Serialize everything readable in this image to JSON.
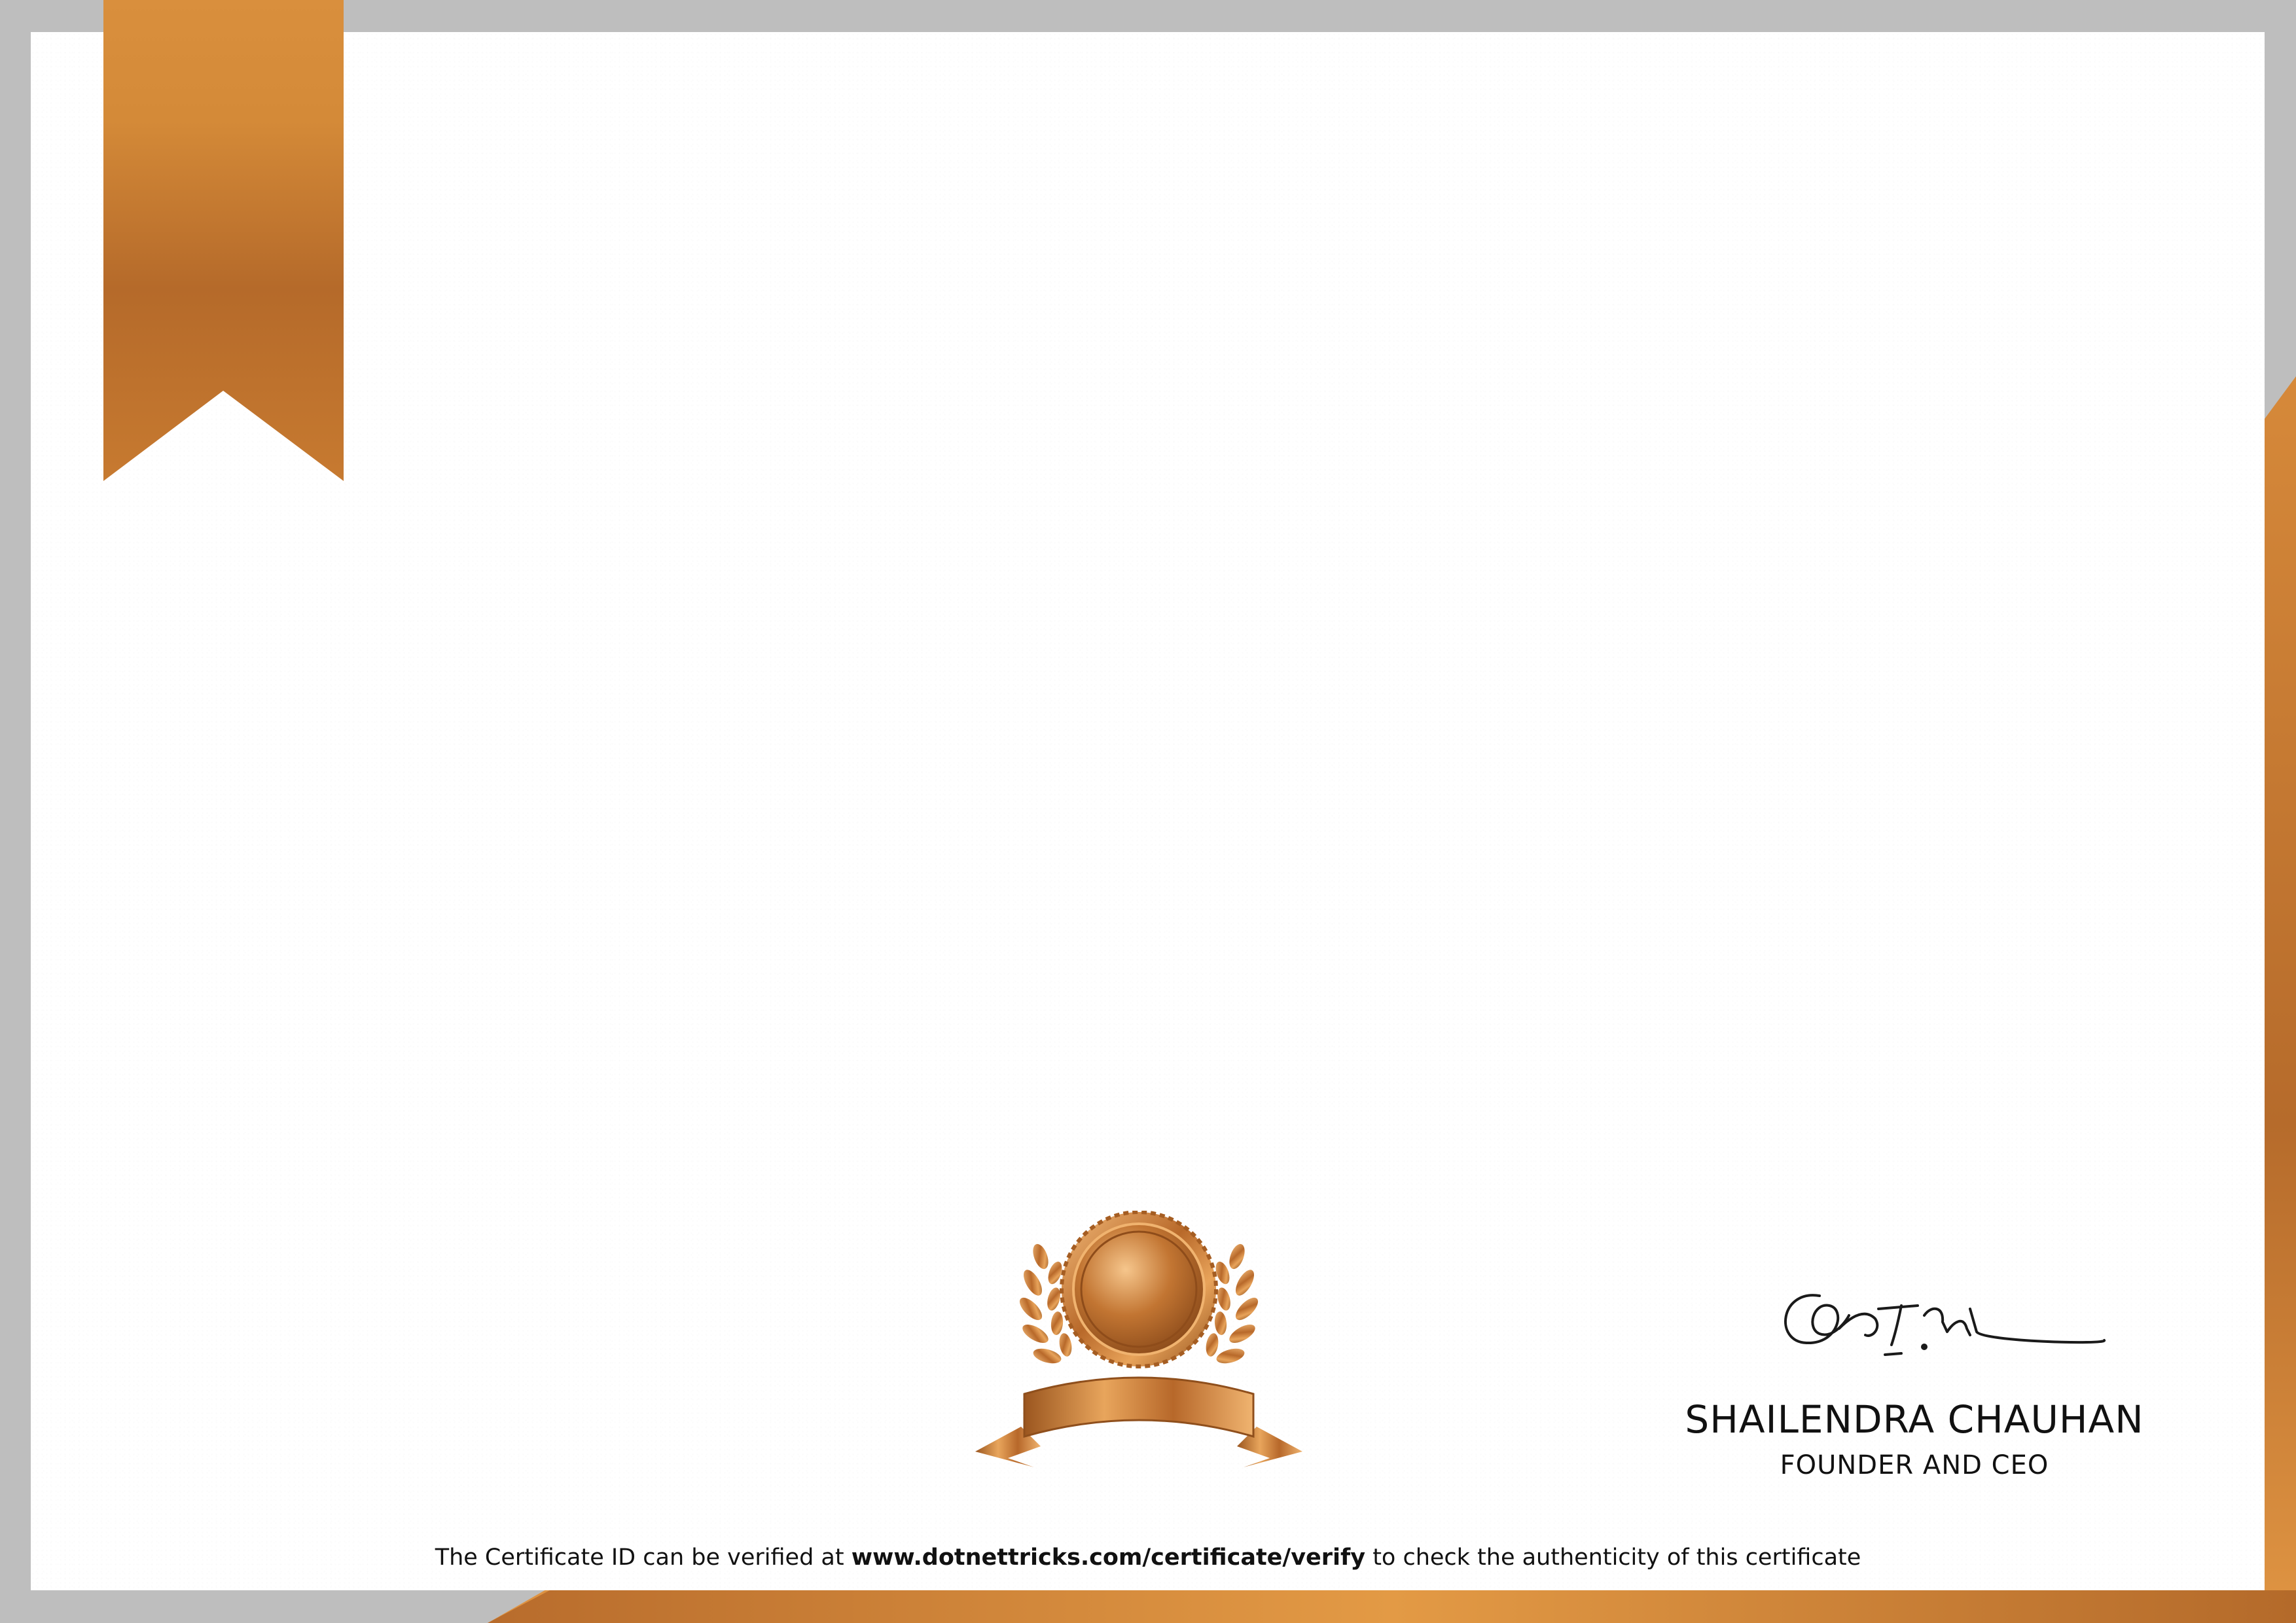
{
  "colors": {
    "frame": "#bebebe",
    "accent": "#c97c34",
    "accent_light": "#e39a45",
    "accent_dark": "#a9642a",
    "text": "#111111"
  },
  "signatory": {
    "name": "SHAILENDRA CHAUHAN",
    "title": "FOUNDER AND CEO"
  },
  "verification": {
    "prefix": "The Certificate ID can be verified at ",
    "url": "www.dotnettricks.com/certificate/verify",
    "suffix": " to check the authenticity of this certificate"
  },
  "decorations": {
    "ribbon_icon": "bookmark-ribbon-icon",
    "seal_icon": "award-seal-icon",
    "signature": "handwritten-signature"
  }
}
